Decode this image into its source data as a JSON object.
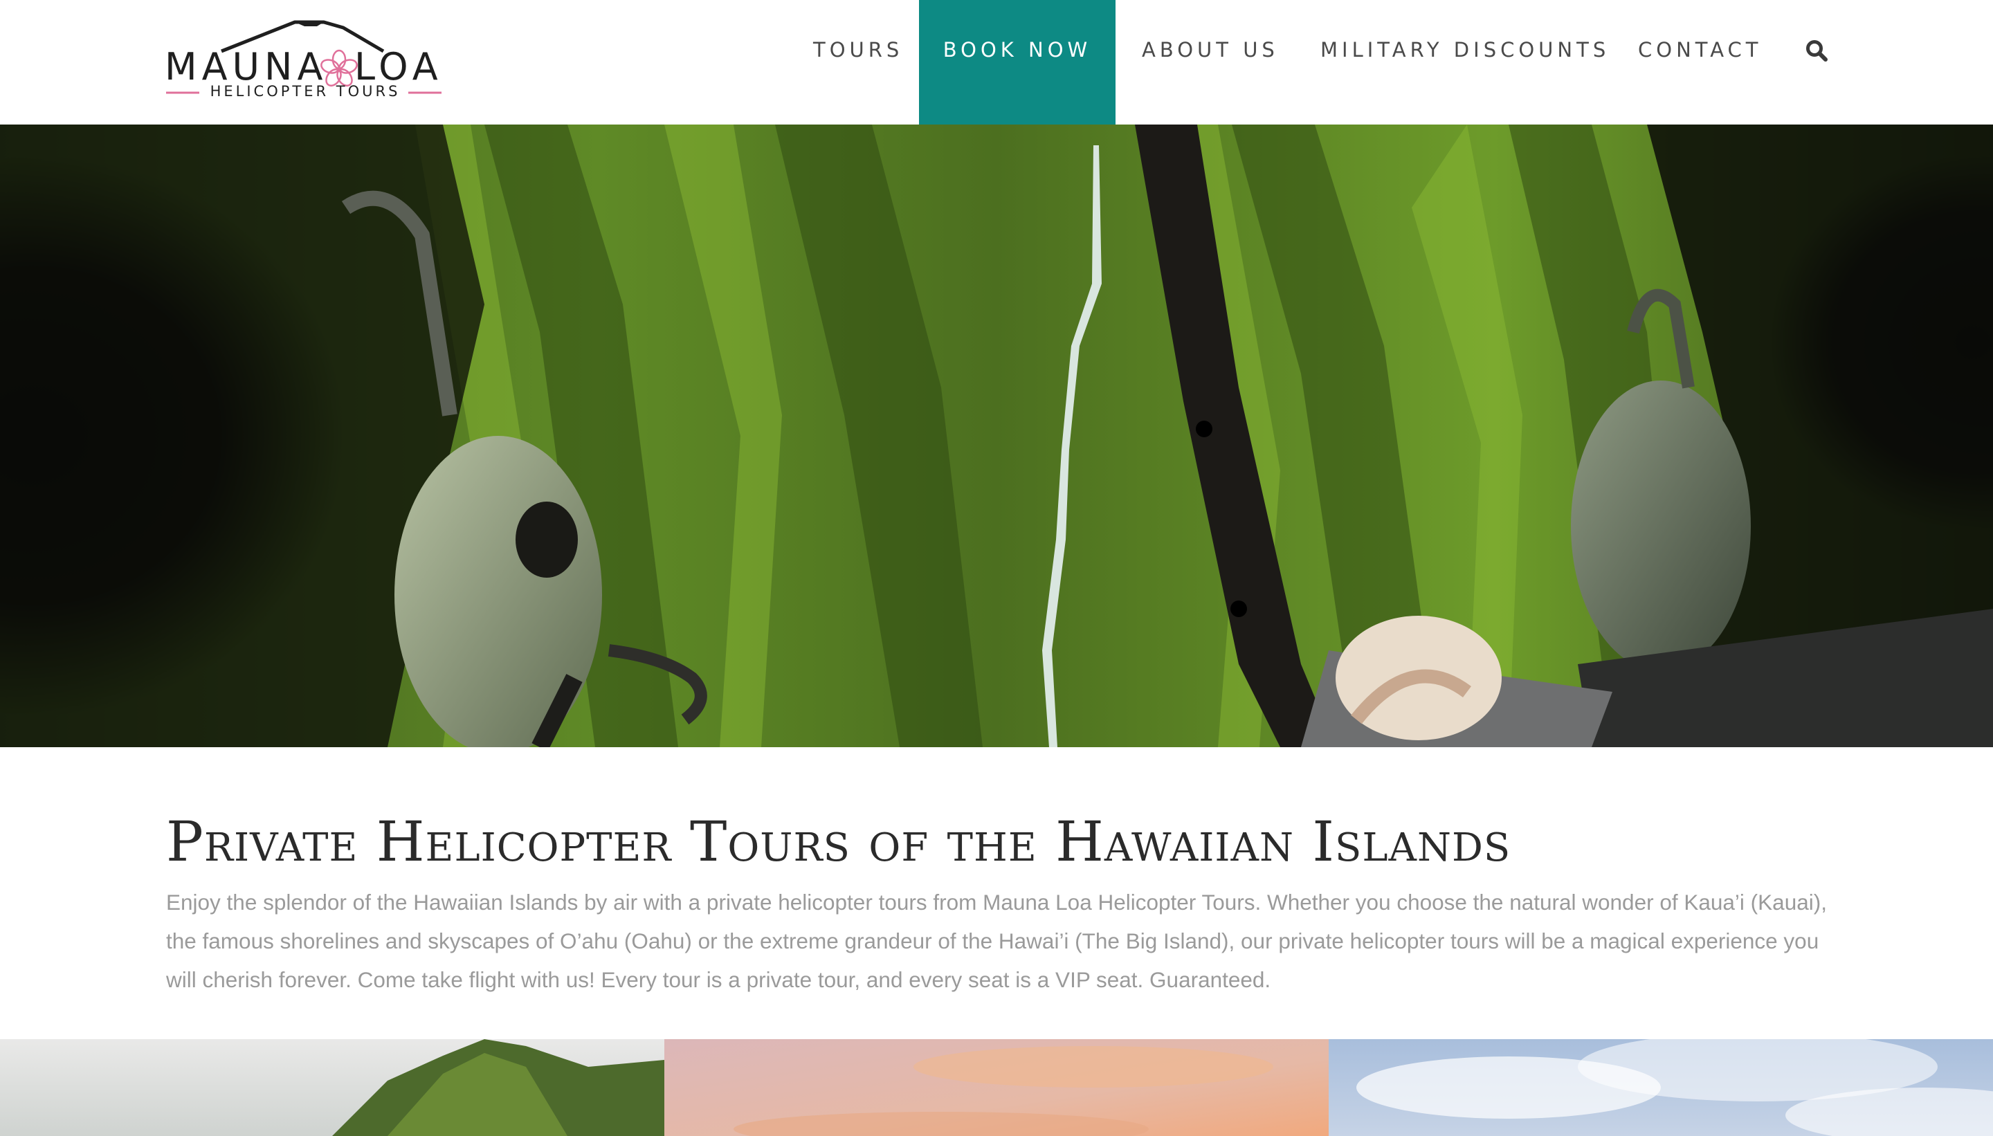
{
  "brand": {
    "name_left": "MAUNA",
    "name_right": "LOA",
    "tagline": "HELICOPTER TOURS",
    "accent_pink": "#e0709a"
  },
  "nav": {
    "items": [
      {
        "label": "TOURS"
      },
      {
        "label": "BOOK NOW",
        "active": true
      },
      {
        "label": "ABOUT US"
      },
      {
        "label": "MILITARY DISCOUNTS"
      },
      {
        "label": "CONTACT"
      }
    ],
    "search_icon": "search-icon",
    "accent_color": "#0d8a84"
  },
  "hero": {
    "image": "aerial view of green valley with waterfall from helicopter cockpit, two passengers wearing headsets"
  },
  "intro": {
    "title": "Private Helicopter Tours of the Hawaiian Islands",
    "body": "Enjoy the splendor of the Hawaiian Islands by air with a private helicopter tours from Mauna Loa Helicopter Tours. Whether you choose the natural wonder of Kaua’i (Kauai), the famous shorelines and skyscapes of O’ahu (Oahu) or the extreme grandeur of the Hawai’i (The Big Island), our private helicopter tours will be a magical experience you will cherish forever. Come take flight with us! Every tour is a private tour, and every seat is a VIP seat. Guaranteed."
  },
  "tiles": [
    {
      "image": "green mountain ridge under hazy sky"
    },
    {
      "image": "pink and orange sunset sky"
    },
    {
      "image": "blue sky with white clouds"
    }
  ]
}
